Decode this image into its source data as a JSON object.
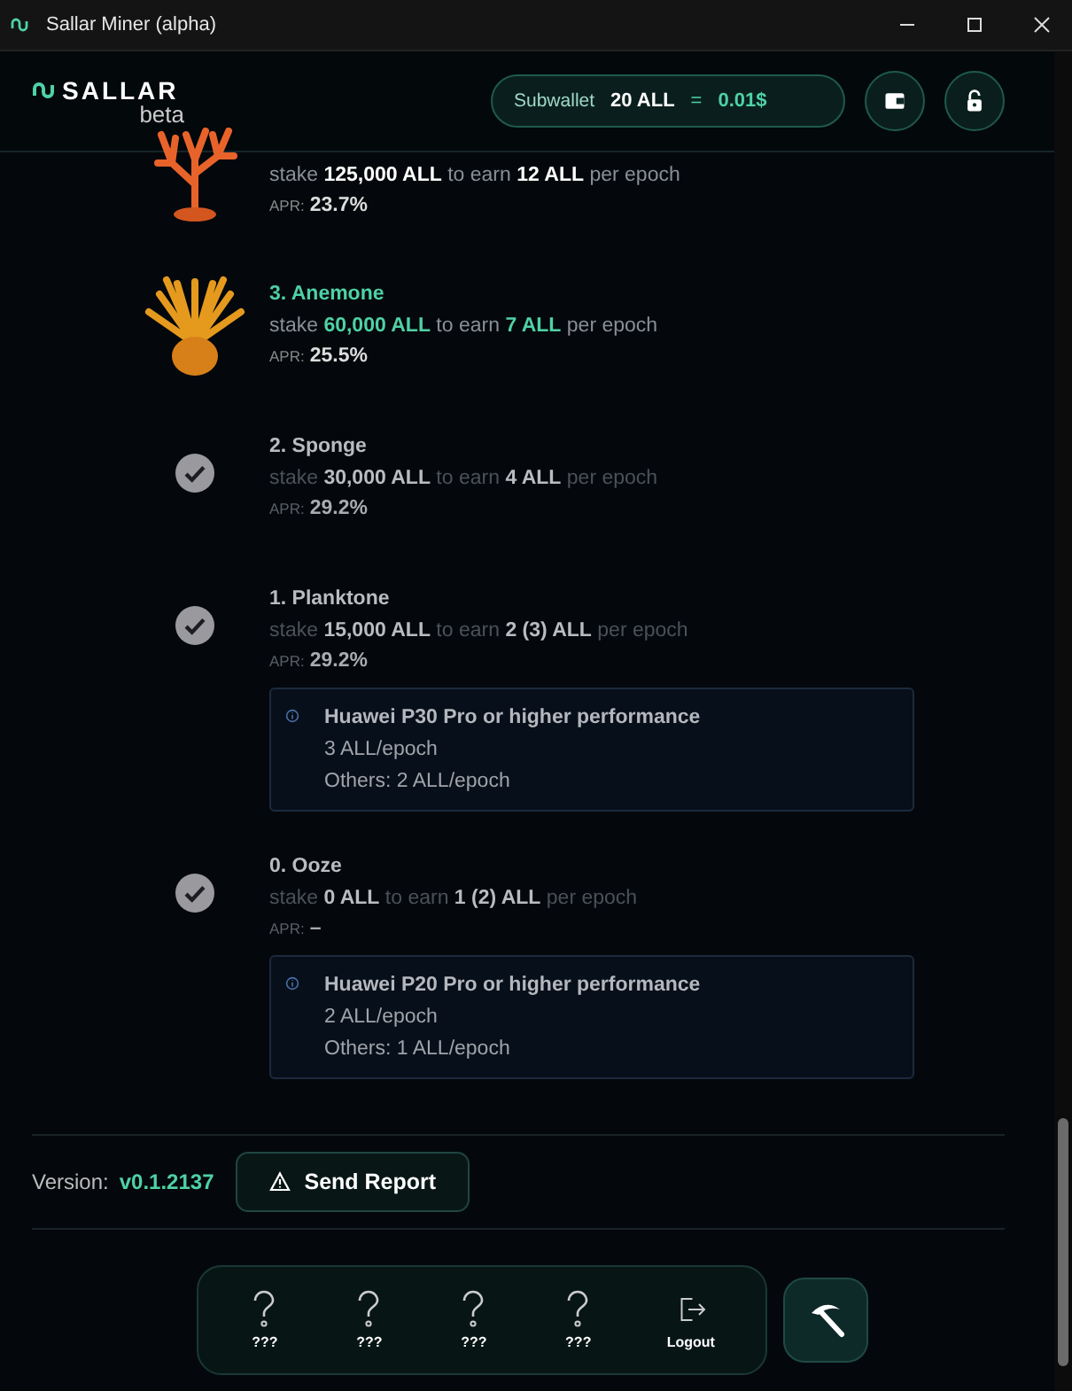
{
  "window": {
    "title": "Sallar Miner (alpha)"
  },
  "header": {
    "logo": "SALLAR",
    "logo_sub": "beta",
    "wallet": {
      "label": "Subwallet",
      "amount": "20 ALL",
      "equals": "=",
      "value": "0.01$"
    }
  },
  "tiers": [
    {
      "kind": "coral",
      "current": false,
      "completed": false,
      "stake_text": "stake **125,000 ALL** to earn **12 ALL** per epoch",
      "apr_label": "APR:",
      "apr": "23.7%"
    },
    {
      "kind": "anemone",
      "current": true,
      "completed": false,
      "title": "3. Anemone",
      "stake_text": "stake **60,000 ALL** to earn **7 ALL** per epoch",
      "apr_label": "APR:",
      "apr": "25.5%"
    },
    {
      "kind": "check",
      "current": false,
      "completed": true,
      "title": "2. Sponge",
      "stake_text": "stake **30,000 ALL** to earn **4 ALL** per epoch",
      "apr_label": "APR:",
      "apr": "29.2%"
    },
    {
      "kind": "check",
      "current": false,
      "completed": true,
      "title": "1. Planktone",
      "stake_text": "stake **15,000 ALL** to earn **2 (3) ALL** per epoch",
      "apr_label": "APR:",
      "apr": "29.2%",
      "note": {
        "title": "Huawei P30 Pro or higher performance",
        "lines": [
          "3 ALL/epoch",
          "Others: 2 ALL/epoch"
        ]
      }
    },
    {
      "kind": "check",
      "current": false,
      "completed": true,
      "title": "0. Ooze",
      "stake_text": "stake **0 ALL** to earn **1 (2) ALL** per epoch",
      "apr_label": "APR:",
      "apr": "–",
      "note": {
        "title": "Huawei P20 Pro or higher performance",
        "lines": [
          "2 ALL/epoch",
          "Others: 1 ALL/epoch"
        ]
      }
    }
  ],
  "footer": {
    "version_label": "Version:",
    "version": "v0.1.2137",
    "report_button": "Send Report"
  },
  "nav": [
    {
      "kind": "unknown",
      "label": "???"
    },
    {
      "kind": "unknown",
      "label": "???"
    },
    {
      "kind": "unknown",
      "label": "???"
    },
    {
      "kind": "unknown",
      "label": "???"
    },
    {
      "kind": "logout",
      "label": "Logout"
    }
  ]
}
